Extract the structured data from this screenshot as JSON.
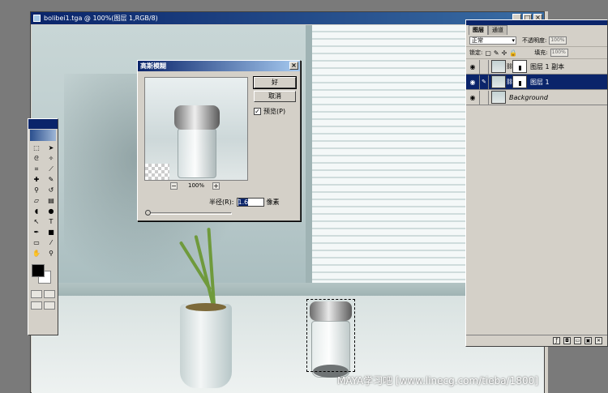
{
  "document": {
    "title": "bolibei1.tga @ 100%(图层 1,RGB/8)",
    "minimize": "_",
    "maximize": "□",
    "close": "×"
  },
  "dialog": {
    "title": "高斯模糊",
    "close": "×",
    "ok_label": "好",
    "cancel_label": "取消",
    "preview_checkbox_mark": "✓",
    "preview_label": "预览(P)",
    "zoom_out": "−",
    "zoom_in": "+",
    "zoom_value": "100%",
    "radius_label": "半径(R):",
    "radius_value": "1.6",
    "radius_unit": "像素"
  },
  "layers_panel": {
    "tabs": [
      "图层",
      "通道"
    ],
    "blend_mode": "正常",
    "opacity_label": "不透明度:",
    "opacity_value": "100%",
    "lock_label": "锁定:",
    "fill_label": "填充:",
    "fill_value": "100%",
    "layers": [
      {
        "name": "图层 1 副本",
        "selected": false,
        "has_mask": true,
        "italic": false
      },
      {
        "name": "图层 1",
        "selected": true,
        "has_mask": true,
        "italic": false
      },
      {
        "name": "Background",
        "selected": false,
        "has_mask": false,
        "italic": true
      }
    ]
  },
  "toolbox": {
    "tools": [
      "marquee-icon",
      "move-icon",
      "lasso-icon",
      "magic-wand-icon",
      "crop-icon",
      "slice-icon",
      "healing-brush-icon",
      "brush-icon",
      "clone-stamp-icon",
      "history-brush-icon",
      "eraser-icon",
      "gradient-icon",
      "blur-icon",
      "dodge-icon",
      "path-select-icon",
      "type-icon",
      "pen-icon",
      "shape-icon",
      "notes-icon",
      "eyedropper-icon",
      "hand-icon",
      "zoom-icon"
    ],
    "foreground_color": "#000000",
    "background_color": "#ffffff"
  },
  "watermark": "MAYA学习吧  [www.lineсg.com/tieba/1800]",
  "colors": {
    "title_bar": "#0a246a",
    "panel": "#d4d0c8",
    "selection": "#0a246a"
  }
}
